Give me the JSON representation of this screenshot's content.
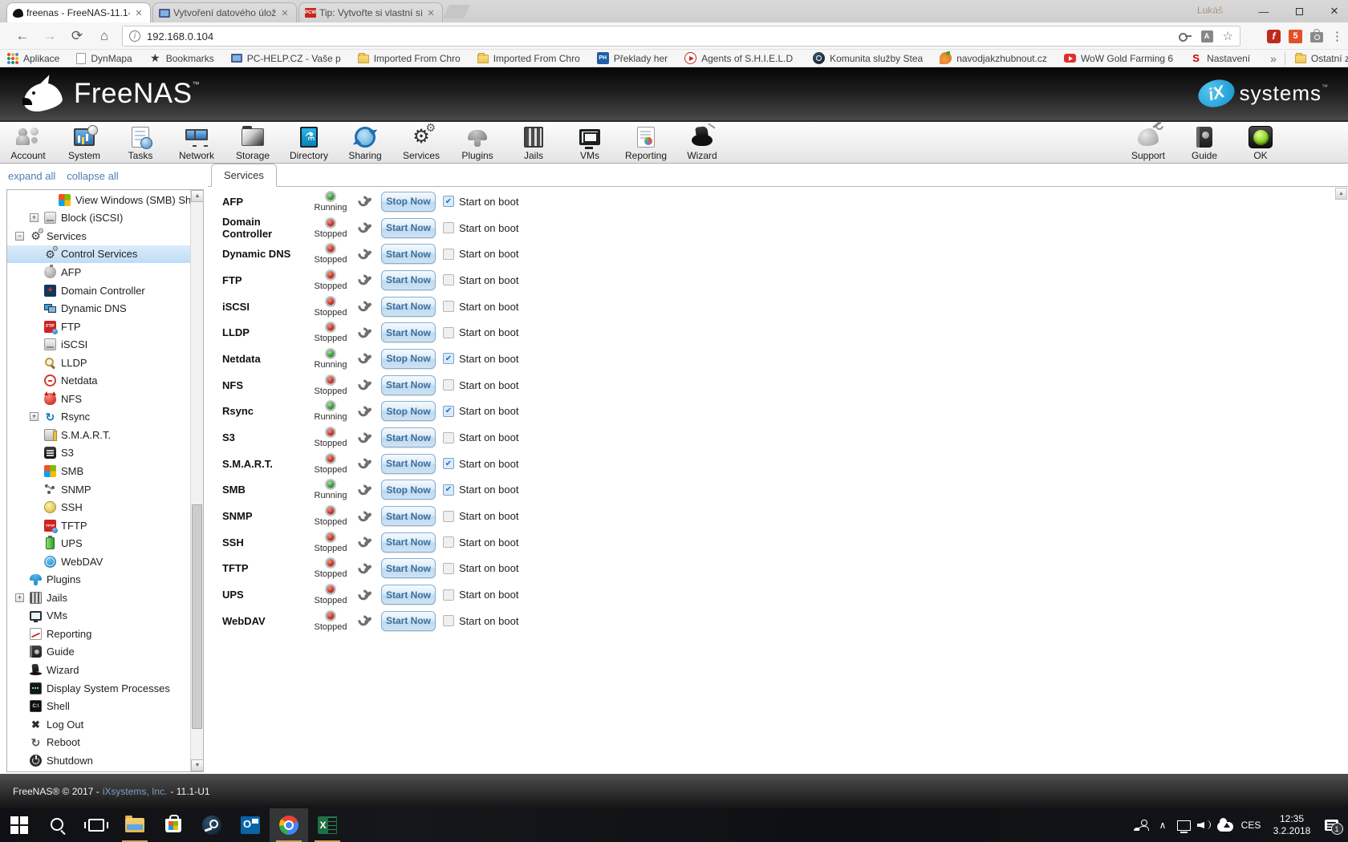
{
  "colors": {
    "running_green": "#2c9b2c",
    "stopped_red": "#d02a1e",
    "selection_blue": "#bedcf5",
    "button_blue": "#3c6e9f",
    "footer_link_blue": "#7d9cc4",
    "taskbar_underline": "#cda45e"
  },
  "browser": {
    "profile_name": "Lukáš",
    "tabs": [
      {
        "title": "freenas - FreeNAS-11.1-U",
        "icon": "freenas-shark-favicon",
        "active": true
      },
      {
        "title": "Vytvoření datového úlož",
        "icon": "monitor-favicon",
        "active": false
      },
      {
        "title": "Tip: Vytvořte si vlastní síť",
        "icon": "pcw-favicon",
        "active": false
      }
    ],
    "tab_close_glyph": "✕",
    "window_controls": {
      "minimize": "—",
      "maximize": "",
      "close": "✕"
    },
    "address": {
      "url": "192.168.0.104",
      "info_glyph": "i"
    },
    "translate_glyph": "A",
    "star_glyph": "☆",
    "flash_glyph": "f",
    "html5_glyph": "5",
    "menu_glyph": "⋮",
    "bookmarks": [
      {
        "label": "Aplikace",
        "icon": "apps-grid-icon"
      },
      {
        "label": "DynMapa",
        "icon": "page-icon"
      },
      {
        "label": "Bookmarks",
        "icon": "star-icon"
      },
      {
        "label": "PC-HELP.CZ - Vaše p",
        "icon": "monitor-icon"
      },
      {
        "label": "Imported From Chro",
        "icon": "folder-icon"
      },
      {
        "label": "Imported From Chro",
        "icon": "folder-icon"
      },
      {
        "label": "Překlady her",
        "icon": "ph-icon",
        "icon_text": "PH"
      },
      {
        "label": "Agents of S.H.I.E.L.D S",
        "icon": "play-icon"
      },
      {
        "label": "Komunita služby Stea",
        "icon": "steam-icon"
      },
      {
        "label": "navodjakzhubnout.cz",
        "icon": "carrot-icon"
      },
      {
        "label": "WoW Gold Farming 6",
        "icon": "youtube-icon"
      },
      {
        "label": "Nastavení",
        "icon": "seznam-icon",
        "icon_text": "S"
      }
    ],
    "overflow_chevron": "»",
    "other_bookmarks": {
      "label": "Ostatní záložky",
      "icon": "folder-icon"
    }
  },
  "freenas": {
    "brand": "FreeNAS",
    "brand_tm": "™",
    "ix_logo": {
      "oval": "iX",
      "text": "systems",
      "tm": "™"
    },
    "toolbar_left": [
      {
        "label": "Account",
        "icon": "account-icon"
      },
      {
        "label": "System",
        "icon": "system-icon"
      },
      {
        "label": "Tasks",
        "icon": "tasks-icon"
      },
      {
        "label": "Network",
        "icon": "network-icon"
      },
      {
        "label": "Storage",
        "icon": "storage-icon"
      },
      {
        "label": "Directory",
        "icon": "directory-icon"
      },
      {
        "label": "Sharing",
        "icon": "sharing-icon"
      },
      {
        "label": "Services",
        "icon": "services-icon"
      },
      {
        "label": "Plugins",
        "icon": "plugins-icon"
      },
      {
        "label": "Jails",
        "icon": "jails-icon"
      },
      {
        "label": "VMs",
        "icon": "vms-icon"
      },
      {
        "label": "Reporting",
        "icon": "reporting-icon"
      },
      {
        "label": "Wizard",
        "icon": "wizard-icon"
      }
    ],
    "toolbar_right": [
      {
        "label": "Support",
        "icon": "support-icon"
      },
      {
        "label": "Guide",
        "icon": "guide-icon"
      },
      {
        "label": "OK",
        "icon": "ok-status-icon"
      }
    ],
    "tree_controls": {
      "expand": "expand all",
      "collapse": "collapse all"
    },
    "sidebar": {
      "items": [
        {
          "label": "View Windows (SMB) Shares",
          "icon": "windows",
          "level": 2
        },
        {
          "label": "Block (iSCSI)",
          "icon": "disk",
          "level": 1,
          "expander": "+"
        },
        {
          "label": "Services",
          "icon": "gears",
          "level": 0,
          "expander": "−"
        },
        {
          "label": "Control Services",
          "icon": "gears",
          "level": 1,
          "selected": true
        },
        {
          "label": "AFP",
          "icon": "apple",
          "level": 1
        },
        {
          "label": "Domain Controller",
          "icon": "domain",
          "level": 1
        },
        {
          "label": "Dynamic DNS",
          "icon": "monitors",
          "level": 1
        },
        {
          "label": "FTP",
          "icon": "ftp",
          "level": 1
        },
        {
          "label": "iSCSI",
          "icon": "disk",
          "level": 1
        },
        {
          "label": "LLDP",
          "icon": "magnifier",
          "level": 1
        },
        {
          "label": "Netdata",
          "icon": "netdata",
          "level": 1
        },
        {
          "label": "NFS",
          "icon": "bsd",
          "level": 1
        },
        {
          "label": "Rsync",
          "icon": "sync",
          "level": 1,
          "expander": "+"
        },
        {
          "label": "S.M.A.R.T.",
          "icon": "smart",
          "level": 1
        },
        {
          "label": "S3",
          "icon": "s3",
          "level": 1
        },
        {
          "label": "SMB",
          "icon": "windows",
          "level": 1
        },
        {
          "label": "SNMP",
          "icon": "snmp",
          "level": 1
        },
        {
          "label": "SSH",
          "icon": "ssh",
          "level": 1
        },
        {
          "label": "TFTP",
          "icon": "tftp",
          "level": 1
        },
        {
          "label": "UPS",
          "icon": "battery",
          "level": 1
        },
        {
          "label": "WebDAV",
          "icon": "globe",
          "level": 1
        },
        {
          "label": "Plugins",
          "icon": "plugin",
          "level": 0
        },
        {
          "label": "Jails",
          "icon": "jails",
          "level": 0,
          "expander": "+"
        },
        {
          "label": "VMs",
          "icon": "vm",
          "level": 0
        },
        {
          "label": "Reporting",
          "icon": "report",
          "level": 0
        },
        {
          "label": "Guide",
          "icon": "book",
          "level": 0
        },
        {
          "label": "Wizard",
          "icon": "hat",
          "level": 0
        },
        {
          "label": "Display System Processes",
          "icon": "processes",
          "level": 0
        },
        {
          "label": "Shell",
          "icon": "shell",
          "level": 0
        },
        {
          "label": "Log Out",
          "icon": "logout",
          "level": 0
        },
        {
          "label": "Reboot",
          "icon": "reboot",
          "level": 0
        },
        {
          "label": "Shutdown",
          "icon": "power",
          "level": 0
        }
      ]
    },
    "services_panel": {
      "tab": "Services",
      "boot_label": "Start on boot",
      "rows": [
        {
          "name": "AFP",
          "status": "running",
          "status_label": "Running",
          "button": "Stop Now",
          "boot": true
        },
        {
          "name": "Domain Controller",
          "status": "stopped",
          "status_label": "Stopped",
          "button": "Start Now",
          "boot": false
        },
        {
          "name": "Dynamic DNS",
          "status": "stopped",
          "status_label": "Stopped",
          "button": "Start Now",
          "boot": false
        },
        {
          "name": "FTP",
          "status": "stopped",
          "status_label": "Stopped",
          "button": "Start Now",
          "boot": false
        },
        {
          "name": "iSCSI",
          "status": "stopped",
          "status_label": "Stopped",
          "button": "Start Now",
          "boot": false
        },
        {
          "name": "LLDP",
          "status": "stopped",
          "status_label": "Stopped",
          "button": "Start Now",
          "boot": false
        },
        {
          "name": "Netdata",
          "status": "running",
          "status_label": "Running",
          "button": "Stop Now",
          "boot": true
        },
        {
          "name": "NFS",
          "status": "stopped",
          "status_label": "Stopped",
          "button": "Start Now",
          "boot": false
        },
        {
          "name": "Rsync",
          "status": "running",
          "status_label": "Running",
          "button": "Stop Now",
          "boot": true
        },
        {
          "name": "S3",
          "status": "stopped",
          "status_label": "Stopped",
          "button": "Start Now",
          "boot": false
        },
        {
          "name": "S.M.A.R.T.",
          "status": "stopped",
          "status_label": "Stopped",
          "button": "Start Now",
          "boot": true
        },
        {
          "name": "SMB",
          "status": "running",
          "status_label": "Running",
          "button": "Stop Now",
          "boot": true
        },
        {
          "name": "SNMP",
          "status": "stopped",
          "status_label": "Stopped",
          "button": "Start Now",
          "boot": false
        },
        {
          "name": "SSH",
          "status": "stopped",
          "status_label": "Stopped",
          "button": "Start Now",
          "boot": false
        },
        {
          "name": "TFTP",
          "status": "stopped",
          "status_label": "Stopped",
          "button": "Start Now",
          "boot": false
        },
        {
          "name": "UPS",
          "status": "stopped",
          "status_label": "Stopped",
          "button": "Start Now",
          "boot": false
        },
        {
          "name": "WebDAV",
          "status": "stopped",
          "status_label": "Stopped",
          "button": "Start Now",
          "boot": false
        }
      ],
      "check_glyph": "✔"
    },
    "footer": {
      "pre": "FreeNAS® © 2017 -",
      "link": "iXsystems, Inc.",
      "post": "- 11.1-U1"
    }
  },
  "taskbar": {
    "items": [
      {
        "name": "start",
        "running": false,
        "active": false
      },
      {
        "name": "search",
        "running": false,
        "active": false
      },
      {
        "name": "taskview",
        "running": false,
        "active": false
      },
      {
        "name": "explorer",
        "running": true,
        "active": false
      },
      {
        "name": "store",
        "running": false,
        "active": false
      },
      {
        "name": "steam",
        "running": false,
        "active": false
      },
      {
        "name": "outlook",
        "running": false,
        "active": false
      },
      {
        "name": "chrome",
        "running": true,
        "active": true
      },
      {
        "name": "excel",
        "running": true,
        "active": false
      }
    ],
    "excel_glyph": "X",
    "tray": {
      "chevron": "∧",
      "language": "CES",
      "time": "12:35",
      "date": "3.2.2018",
      "badge": "1"
    }
  }
}
